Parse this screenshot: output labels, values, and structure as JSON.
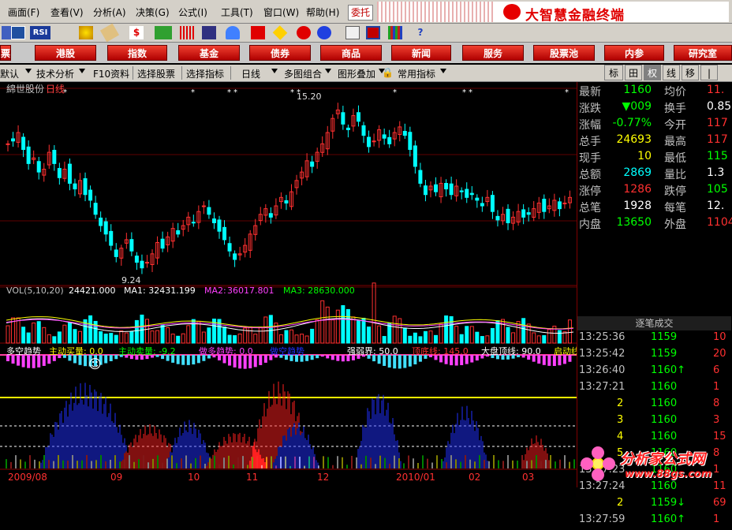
{
  "menu": {
    "items": [
      "画面(F)",
      "查看(V)",
      "分析(A)",
      "决策(G)",
      "公式(I)",
      "工具(T)",
      "窗口(W)",
      "帮助(H)"
    ],
    "weituo": "委托",
    "brand": "大智慧金融终端"
  },
  "toolbar": {
    "rsi_label": "RSI",
    "icons": [
      "chart-icon",
      "grid-icon",
      "rsi-icon",
      "crosshair-icon",
      "ruler-icon",
      "dollar-icon",
      "eyes-icon",
      "bars-icon",
      "binoculars-icon",
      "alarm-icon",
      "flag-icon",
      "diamond-icon",
      "link-icon",
      "chain-icon",
      "window-icon",
      "panel-icon",
      "books-icon",
      "help-icon"
    ]
  },
  "redbar": {
    "buttons": [
      "港股",
      "指数",
      "基金",
      "债券",
      "商品",
      "新闻",
      "服务",
      "股票池",
      "内参",
      "研究室"
    ],
    "right_tabs": [
      "标",
      "田",
      "权",
      "线",
      "移",
      "|"
    ]
  },
  "tabbar": {
    "items": [
      "默认",
      "技术分析",
      "F10资料",
      "选择股票",
      "选择指标",
      "日线",
      "多图组合",
      "图形叠加",
      "常用指标"
    ]
  },
  "chart": {
    "stock_name": "綿世股份",
    "period": "日线",
    "high_label": "15.20",
    "low_label": "9.24",
    "vol_legend": {
      "name": "VOL(5,10,20)",
      "vol": "24421.000",
      "ma1": "MA1: 32431.199",
      "ma2_label": "MA2:",
      "ma2": "36017.801",
      "ma3": "MA3: 28630.000"
    },
    "ind_legend": {
      "a": "多空趋势",
      "b": "主动买量: 0.0",
      "c": "主动卖量: -9.2",
      "d": "做多趋势: 0.0",
      "e": "做空趋势",
      "f": "强弱界: 50.0",
      "g": "顶底线: 145.0",
      "h": "大盘顶线: 90.0",
      "i": "启动线"
    },
    "axis_labels": [
      "2009/08",
      "09",
      "10",
      "11",
      "12",
      "2010/01",
      "02",
      "03"
    ],
    "smiley": "☺"
  },
  "chart_data": {
    "type": "line",
    "title": "綿世股份 日线",
    "price_range": [
      9.24,
      15.2
    ],
    "annotations": [
      "15.20",
      "9.24"
    ],
    "candles_close": [
      13.8,
      13.9,
      14.2,
      13.6,
      13.1,
      13.3,
      12.8,
      12.9,
      13.5,
      13.1,
      12.6,
      12.9,
      12.4,
      12.2,
      12.5,
      12.0,
      11.8,
      11.3,
      10.9,
      10.6,
      10.2,
      9.8,
      10.1,
      10.4,
      10.0,
      9.6,
      9.4,
      9.6,
      9.9,
      10.3,
      10.1,
      10.5,
      10.8,
      10.6,
      10.9,
      11.2,
      11.0,
      11.4,
      11.6,
      11.3,
      11.0,
      10.7,
      10.4,
      10.0,
      9.7,
      9.9,
      10.2,
      10.6,
      10.9,
      11.3,
      11.5,
      11.2,
      11.6,
      11.9,
      11.7,
      12.1,
      12.5,
      12.8,
      13.2,
      13.0,
      13.5,
      13.8,
      14.2,
      14.7,
      15.0,
      14.5,
      14.3,
      14.8,
      14.6,
      14.1,
      13.7,
      13.9,
      14.3,
      14.0,
      13.8,
      14.2,
      14.4,
      14.1,
      13.6,
      13.0,
      12.4,
      12.0,
      12.3,
      12.1,
      12.4,
      12.2,
      12.0,
      12.3,
      12.1,
      11.9,
      12.0,
      11.8,
      11.6,
      11.9,
      11.4,
      11.1,
      11.3,
      11.0,
      11.2,
      11.4,
      11.2,
      11.3,
      11.5,
      11.7,
      11.4,
      11.6,
      11.8,
      11.5,
      11.7,
      11.9
    ],
    "volume_legend": {
      "VOL": 24421.0,
      "MA1": 32431.199,
      "MA2": 36017.801,
      "MA3": 28630.0
    }
  },
  "quote": {
    "rows": [
      {
        "l1": "最新",
        "v1": "1160",
        "c1": "#00ff00",
        "l2": "均价",
        "v2": "11.",
        "c2": "#ff3030"
      },
      {
        "l1": "涨跌",
        "v1": "▼009",
        "c1": "#00ff00",
        "l2": "换手",
        "v2": "0.85",
        "c2": "#ffffff"
      },
      {
        "l1": "涨幅",
        "v1": "-0.77%",
        "c1": "#00ff00",
        "l2": "今开",
        "v2": "117",
        "c2": "#ff3030"
      },
      {
        "l1": "总手",
        "v1": "24693",
        "c1": "#ffff00",
        "l2": "最高",
        "v2": "117",
        "c2": "#ff3030"
      },
      {
        "l1": "现手",
        "v1": "10",
        "c1": "#ffff00",
        "l2": "最低",
        "v2": "115",
        "c2": "#00ff00"
      },
      {
        "l1": "总额",
        "v1": "2869",
        "c1": "#00ffff",
        "l2": "量比",
        "v2": "1.3",
        "c2": "#ffffff"
      },
      {
        "l1": "涨停",
        "v1": "1286",
        "c1": "#ff3030",
        "l2": "跌停",
        "v2": "105",
        "c2": "#00ff00"
      },
      {
        "l1": "总笔",
        "v1": "1928",
        "c1": "#ffffff",
        "l2": "每笔",
        "v2": "12.",
        "c2": "#ffffff"
      },
      {
        "l1": "内盘",
        "v1": "13650",
        "c1": "#00ff00",
        "l2": "外盘",
        "v2": "1104",
        "c2": "#ff3030"
      }
    ],
    "ticks_title": "逐笔成交",
    "ticks": [
      {
        "t": "13:25:36",
        "p": "1159",
        "v": "10",
        "pc": "#00ff00"
      },
      {
        "t": "13:25:42",
        "p": "1159",
        "v": "20",
        "pc": "#00ff00"
      },
      {
        "t": "13:26:40",
        "p": "1160↑",
        "v": "6",
        "pc": "#00ff00"
      },
      {
        "t": "13:27:21",
        "p": "1160",
        "v": "1",
        "pc": "#00ff00"
      },
      {
        "t": "2",
        "p": "1160",
        "v": "8",
        "pc": "#00ff00"
      },
      {
        "t": "3",
        "p": "1160",
        "v": "3",
        "pc": "#00ff00"
      },
      {
        "t": "4",
        "p": "1160",
        "v": "15",
        "pc": "#00ff00"
      },
      {
        "t": "5",
        "p": "1160",
        "v": "8",
        "pc": "#00ff00"
      },
      {
        "t": "13:27:23",
        "p": "1160",
        "v": "1",
        "pc": "#00ff00"
      },
      {
        "t": "13:27:24",
        "p": "1160",
        "v": "11",
        "pc": "#00ff00"
      },
      {
        "t": "2",
        "p": "1159↓",
        "v": "69",
        "pc": "#00ff00"
      },
      {
        "t": "13:27:59",
        "p": "1160↑",
        "v": "1",
        "pc": "#00ff00"
      }
    ]
  },
  "watermark": {
    "title": "分析家公式网",
    "url": "www.88gs.com"
  },
  "colors": {
    "up": "#ff3030",
    "down": "#00ffff",
    "blue_bar": "#2030ff",
    "yellow": "#ffff00",
    "magenta": "#ff40ff"
  }
}
